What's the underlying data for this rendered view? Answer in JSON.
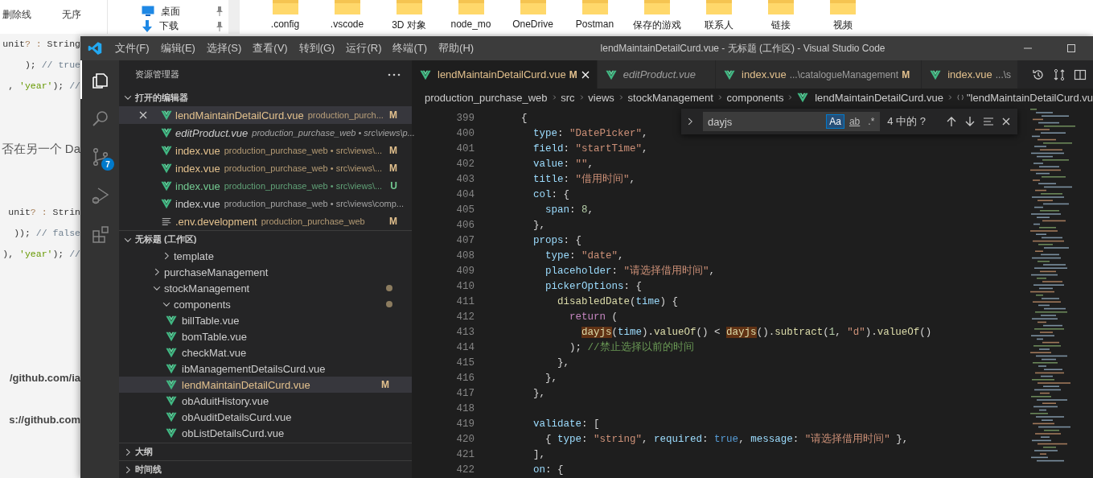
{
  "desktop": {
    "toolbar": [
      {
        "label": "删除线"
      },
      {
        "label": "无序"
      }
    ],
    "nav_pane": [
      {
        "kind": "desktop",
        "label": "桌面",
        "pinned": true
      },
      {
        "kind": "downloads",
        "label": "下载",
        "pinned": true
      }
    ],
    "folders": [
      ".config",
      ".vscode",
      "3D 对象",
      "node_mo",
      "OneDrive",
      "Postman",
      "保存的游戏",
      "联系人",
      "链接",
      "视频"
    ],
    "document": [
      {
        "kind": "code",
        "lines": [
          [
            {
              "kind": "plain",
              "text": "unit"
            },
            {
              "kind": "op",
              "text": "? :"
            },
            {
              "kind": "plain",
              "text": " String"
            }
          ],
          [
            {
              "kind": "plain",
              "text": "); "
            },
            {
              "kind": "comment",
              "text": "// true"
            }
          ],
          [
            {
              "kind": "plain",
              "text": ", "
            },
            {
              "kind": "string",
              "text": "'year'"
            },
            {
              "kind": "plain",
              "text": "); "
            },
            {
              "kind": "comment",
              "text": "//"
            }
          ]
        ]
      },
      {
        "kind": "text",
        "text": "否在另一个 Da"
      },
      {
        "kind": "code",
        "lines": [
          [
            {
              "kind": "plain",
              "text": "unit"
            },
            {
              "kind": "op",
              "text": "? :"
            },
            {
              "kind": "plain",
              "text": " Strin"
            }
          ],
          [
            {
              "kind": "plain",
              "text": ")); "
            },
            {
              "kind": "comment",
              "text": "// false"
            }
          ],
          [
            {
              "kind": "plain",
              "text": "), "
            },
            {
              "kind": "string",
              "text": "'year'"
            },
            {
              "kind": "plain",
              "text": "); "
            },
            {
              "kind": "comment",
              "text": "//"
            }
          ]
        ]
      },
      {
        "kind": "link",
        "text": "/github.com/ia"
      },
      {
        "kind": "link",
        "text": "s://github.com"
      }
    ]
  },
  "vscode": {
    "menu": [
      "文件(F)",
      "编辑(E)",
      "选择(S)",
      "查看(V)",
      "转到(G)",
      "运行(R)",
      "终端(T)",
      "帮助(H)"
    ],
    "title": "lendMaintainDetailCurd.vue - 无标题 (工作区) - Visual Studio Code",
    "activity_bar": [
      {
        "kind": "explorer",
        "selected": true
      },
      {
        "kind": "search",
        "selected": false
      },
      {
        "kind": "source-control",
        "selected": false,
        "badge": "7"
      },
      {
        "kind": "run-debug",
        "selected": false
      },
      {
        "kind": "extensions",
        "selected": false
      }
    ],
    "sidebar": {
      "title": "资源管理器",
      "open_editors": {
        "title": "打开的编辑器",
        "expanded": true,
        "items": [
          {
            "kind": "vue",
            "name": "lendMaintainDetailCurd.vue",
            "path": "production_purch...",
            "modified": true,
            "untracked": false,
            "badge": "M",
            "preview": false,
            "selected": true
          },
          {
            "kind": "vue",
            "name": "editProduct.vue",
            "path": "production_purchase_web • src\\views\\p...",
            "modified": false,
            "untracked": false,
            "preview": true,
            "selected": false
          },
          {
            "kind": "vue",
            "name": "index.vue",
            "path": "production_purchase_web • src\\views\\...",
            "modified": true,
            "untracked": false,
            "badge": "M",
            "preview": false,
            "selected": false
          },
          {
            "kind": "vue",
            "name": "index.vue",
            "path": "production_purchase_web • src\\views\\...",
            "modified": true,
            "untracked": false,
            "badge": "M",
            "preview": false,
            "selected": false
          },
          {
            "kind": "vue",
            "name": "index.vue",
            "path": "production_purchase_web • src\\views\\...",
            "modified": false,
            "untracked": true,
            "badge": "U",
            "preview": false,
            "selected": false
          },
          {
            "kind": "vue",
            "name": "index.vue",
            "path": "production_purchase_web • src\\views\\comp...",
            "modified": false,
            "untracked": false,
            "preview": false,
            "selected": false
          },
          {
            "kind": "text",
            "name": ".env.development",
            "path": "production_purchase_web",
            "modified": true,
            "untracked": false,
            "badge": "M",
            "preview": false,
            "selected": false
          }
        ]
      },
      "workspace": {
        "title": "无标题 (工作区)",
        "expanded": true,
        "items": [
          {
            "children": [
              {
                "kind": "folder",
                "name": "template",
                "expanded": false,
                "modified": false
              }
            ]
          },
          {
            "kind": "folder",
            "name": "purchaseManagement",
            "expanded": false,
            "modified": false
          },
          {
            "kind": "folder",
            "name": "stockManagement",
            "expanded": true,
            "modified": true,
            "children": [
              {
                "kind": "folder",
                "name": "components",
                "expanded": true,
                "modified": true,
                "children": [
                  {
                    "kind": "vue",
                    "name": "billTable.vue",
                    "modified": false,
                    "selected": false
                  },
                  {
                    "kind": "vue",
                    "name": "bomTable.vue",
                    "modified": false,
                    "selected": false
                  },
                  {
                    "kind": "vue",
                    "name": "checkMat.vue",
                    "modified": false,
                    "selected": false
                  },
                  {
                    "kind": "vue",
                    "name": "ibManagementDetailsCurd.vue",
                    "modified": false,
                    "selected": false
                  },
                  {
                    "kind": "vue",
                    "name": "lendMaintainDetailCurd.vue",
                    "modified": true,
                    "badge": "M",
                    "selected": true
                  },
                  {
                    "kind": "vue",
                    "name": "obAduitHistory.vue",
                    "modified": false,
                    "selected": false
                  },
                  {
                    "kind": "vue",
                    "name": "obAuditDetailsCurd.vue",
                    "modified": false,
                    "selected": false
                  },
                  {
                    "kind": "vue",
                    "name": "obListDetailsCurd.vue",
                    "modified": false,
                    "selected": false
                  }
                ]
              }
            ]
          }
        ]
      },
      "sections": [
        {
          "title": "大纲",
          "expanded": false
        },
        {
          "title": "时间线",
          "expanded": false
        }
      ]
    },
    "tabs": [
      {
        "name": "lendMaintainDetailCurd.vue",
        "modified": true,
        "badge": "M",
        "preview": false,
        "selected": true
      },
      {
        "name": "editProduct.vue",
        "modified": false,
        "preview": true,
        "selected": false
      },
      {
        "name": "index.vue",
        "detail": "...\\catalogueManagement",
        "modified": true,
        "badge": "M",
        "preview": false,
        "selected": false
      },
      {
        "name": "index.vue",
        "detail": "...\\s",
        "modified": true,
        "preview": false,
        "selected": false
      }
    ],
    "breadcrumb": [
      {
        "kind": "folder",
        "label": "production_purchase_web"
      },
      {
        "kind": "folder",
        "label": "src"
      },
      {
        "kind": "folder",
        "label": "views"
      },
      {
        "kind": "folder",
        "label": "stockManagement"
      },
      {
        "kind": "folder",
        "label": "components"
      },
      {
        "kind": "vue",
        "label": "lendMaintainDetailCurd.vue"
      },
      {
        "kind": "object",
        "label": "\"lendMaintainDetailCurd.vu"
      }
    ],
    "find": {
      "value": "dayjs",
      "options": [
        {
          "label": "Aa",
          "on": true
        },
        {
          "label": "ab",
          "on": false
        },
        {
          "label": ".*",
          "on": false
        }
      ],
      "count": "4 中的 ?"
    },
    "lines": [
      {
        "number": "399",
        "tokens": [
          {
            "kind": "punct",
            "text": "{"
          }
        ]
      },
      {
        "number": "400",
        "tokens": [
          {
            "kind": "key",
            "text": "type"
          },
          {
            "kind": "punct",
            "text": ": "
          },
          {
            "kind": "string",
            "text": "\"DatePicker\""
          },
          {
            "kind": "punct",
            "text": ","
          }
        ]
      },
      {
        "number": "401",
        "tokens": [
          {
            "kind": "key",
            "text": "field"
          },
          {
            "kind": "punct",
            "text": ": "
          },
          {
            "kind": "string",
            "text": "\"startTime\""
          },
          {
            "kind": "punct",
            "text": ","
          }
        ]
      },
      {
        "number": "402",
        "tokens": [
          {
            "kind": "key",
            "text": "value"
          },
          {
            "kind": "punct",
            "text": ": "
          },
          {
            "kind": "string",
            "text": "\"\""
          },
          {
            "kind": "punct",
            "text": ","
          }
        ]
      },
      {
        "number": "403",
        "tokens": [
          {
            "kind": "key",
            "text": "title"
          },
          {
            "kind": "punct",
            "text": ": "
          },
          {
            "kind": "string",
            "text": "\"借用时间\""
          },
          {
            "kind": "punct",
            "text": ","
          }
        ]
      },
      {
        "number": "404",
        "tokens": [
          {
            "kind": "key",
            "text": "col"
          },
          {
            "kind": "punct",
            "text": ": {"
          }
        ]
      },
      {
        "number": "405",
        "tokens": [
          {
            "kind": "key",
            "text": "span"
          },
          {
            "kind": "punct",
            "text": ": "
          },
          {
            "kind": "number",
            "text": "8"
          },
          {
            "kind": "punct",
            "text": ","
          }
        ]
      },
      {
        "number": "406",
        "tokens": [
          {
            "kind": "punct",
            "text": "},"
          }
        ]
      },
      {
        "number": "407",
        "tokens": [
          {
            "kind": "key",
            "text": "props"
          },
          {
            "kind": "punct",
            "text": ": {"
          }
        ]
      },
      {
        "number": "408",
        "tokens": [
          {
            "kind": "key",
            "text": "type"
          },
          {
            "kind": "punct",
            "text": ": "
          },
          {
            "kind": "string",
            "text": "\"date\""
          },
          {
            "kind": "punct",
            "text": ","
          }
        ]
      },
      {
        "number": "409",
        "tokens": [
          {
            "kind": "key",
            "text": "placeholder"
          },
          {
            "kind": "punct",
            "text": ": "
          },
          {
            "kind": "string",
            "text": "\"请选择借用时间\""
          },
          {
            "kind": "punct",
            "text": ","
          }
        ]
      },
      {
        "number": "410",
        "tokens": [
          {
            "kind": "key",
            "text": "pickerOptions"
          },
          {
            "kind": "punct",
            "text": ": {"
          }
        ]
      },
      {
        "number": "411",
        "tokens": [
          {
            "kind": "function",
            "text": "disabledDate"
          },
          {
            "kind": "punct",
            "text": "("
          },
          {
            "kind": "key",
            "text": "time"
          },
          {
            "kind": "punct",
            "text": ") {"
          }
        ]
      },
      {
        "number": "412",
        "tokens": [
          {
            "kind": "keyword",
            "text": "return"
          },
          {
            "kind": "punct",
            "text": " ("
          }
        ]
      },
      {
        "number": "413",
        "tokens": [
          {
            "kind": "match",
            "text": "dayjs"
          },
          {
            "kind": "punct",
            "text": "("
          },
          {
            "kind": "key",
            "text": "time"
          },
          {
            "kind": "punct",
            "text": ")."
          },
          {
            "kind": "function",
            "text": "valueOf"
          },
          {
            "kind": "punct",
            "text": "() < "
          },
          {
            "kind": "match",
            "text": "dayjs"
          },
          {
            "kind": "punct",
            "text": "()."
          },
          {
            "kind": "function",
            "text": "subtract"
          },
          {
            "kind": "punct",
            "text": "("
          },
          {
            "kind": "number",
            "text": "1"
          },
          {
            "kind": "punct",
            "text": ", "
          },
          {
            "kind": "string",
            "text": "\"d\""
          },
          {
            "kind": "punct",
            "text": ")."
          },
          {
            "kind": "function",
            "text": "valueOf"
          },
          {
            "kind": "punct",
            "text": "()"
          }
        ]
      },
      {
        "number": "414",
        "tokens": [
          {
            "kind": "punct",
            "text": "); "
          },
          {
            "kind": "comment",
            "text": "//禁止选择以前的时间"
          }
        ]
      },
      {
        "number": "415",
        "tokens": [
          {
            "kind": "punct",
            "text": "},"
          }
        ]
      },
      {
        "number": "416",
        "tokens": [
          {
            "kind": "punct",
            "text": "},"
          }
        ]
      },
      {
        "number": "417",
        "tokens": [
          {
            "kind": "punct",
            "text": "},"
          }
        ]
      },
      {
        "number": "418"
      },
      {
        "number": "419",
        "tokens": [
          {
            "kind": "key",
            "text": "validate"
          },
          {
            "kind": "punct",
            "text": ": ["
          }
        ]
      },
      {
        "number": "420",
        "tokens": [
          {
            "kind": "punct",
            "text": "{ "
          },
          {
            "kind": "key",
            "text": "type"
          },
          {
            "kind": "punct",
            "text": ": "
          },
          {
            "kind": "string",
            "text": "\"string\""
          },
          {
            "kind": "punct",
            "text": ", "
          },
          {
            "kind": "key",
            "text": "required"
          },
          {
            "kind": "punct",
            "text": ": "
          },
          {
            "kind": "boolean",
            "text": "true"
          },
          {
            "kind": "punct",
            "text": ", "
          },
          {
            "kind": "key",
            "text": "message"
          },
          {
            "kind": "punct",
            "text": ": "
          },
          {
            "kind": "string",
            "text": "\"请选择借用时间\""
          },
          {
            "kind": "punct",
            "text": " },"
          }
        ]
      },
      {
        "number": "421",
        "tokens": [
          {
            "kind": "punct",
            "text": "],"
          }
        ]
      },
      {
        "number": "422",
        "tokens": [
          {
            "kind": "key",
            "text": "on"
          },
          {
            "kind": "punct",
            "text": ": {"
          }
        ]
      }
    ]
  }
}
